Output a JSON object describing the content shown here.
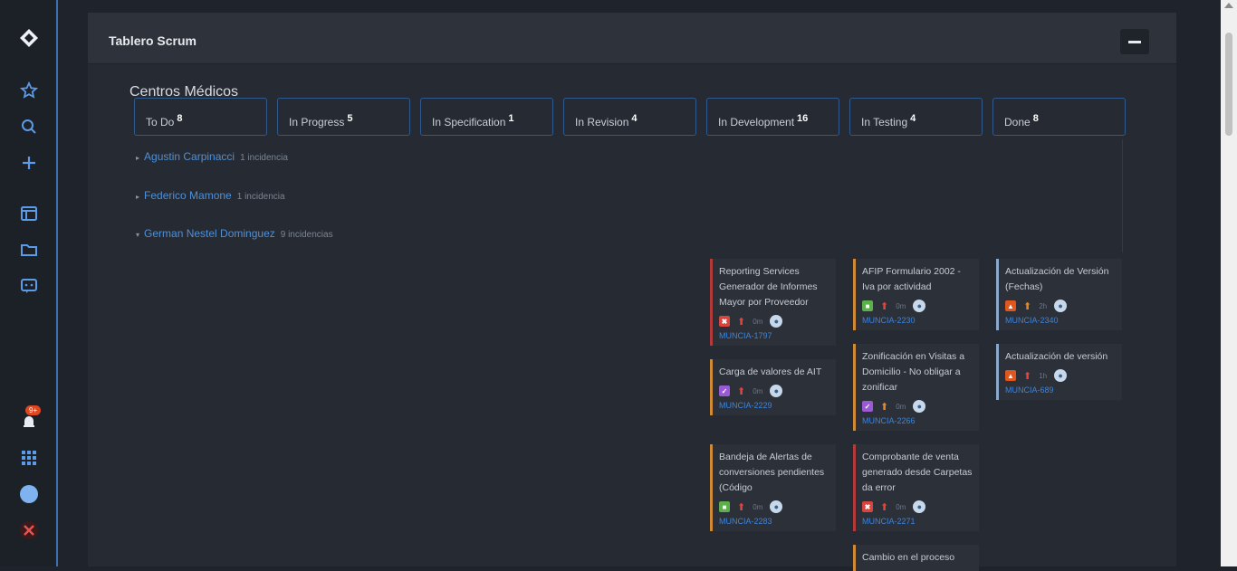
{
  "sidebar": {
    "icons": [
      "jira-logo-icon",
      "star-icon",
      "search-icon",
      "plus-icon",
      "board-icon",
      "folder-icon",
      "feedback-icon",
      "notifications-icon",
      "apps-grid-icon",
      "help-icon",
      "user-avatar-icon"
    ],
    "notification_badge": "9+"
  },
  "panel": {
    "title": "Tablero Scrum",
    "project_title": "Centros Médicos"
  },
  "columns": [
    {
      "name": "To Do",
      "count": "8"
    },
    {
      "name": "In Progress",
      "count": "5"
    },
    {
      "name": "In Specification",
      "count": "1"
    },
    {
      "name": "In Revision",
      "count": "4"
    },
    {
      "name": "In Development",
      "count": "16"
    },
    {
      "name": "In Testing",
      "count": "4"
    },
    {
      "name": "Done",
      "count": "8"
    }
  ],
  "swimlanes": [
    {
      "name": "Agustin Carpinacci",
      "count": "1 incidencia",
      "expanded": false
    },
    {
      "name": "Federico Mamone",
      "count": "1 incidencia",
      "expanded": false
    },
    {
      "name": "German Nestel Dominguez",
      "count": "9 incidencias",
      "expanded": true
    }
  ],
  "cards": {
    "in_development": [
      {
        "title": "Reporting Services Generador de Informes Mayor por Proveedor",
        "type": "bug",
        "estimate": "0m",
        "key": "MUNCIA-1797",
        "accent": "#b33a3a"
      },
      {
        "title": "Carga de valores de AIT",
        "type": "task",
        "estimate": "0m",
        "key": "MUNCIA-2229",
        "accent": "#d08a35"
      },
      {
        "title": "Bandeja de Alertas de conversiones pendientes (Código",
        "type": "story",
        "estimate": "0m",
        "key": "MUNCIA-2283",
        "accent": "#d08a35"
      }
    ],
    "in_testing": [
      {
        "title": "AFIP Formulario 2002 - Iva por actividad",
        "type": "story",
        "estimate": "0m",
        "key": "MUNCIA-2230",
        "accent": "#d08a35"
      },
      {
        "title": "Zonificación en Visitas a Domicilio - No obligar a zonificar",
        "type": "task",
        "estimate": "0m",
        "key": "MUNCIA-2266",
        "accent": "#d08a35"
      },
      {
        "title": "Comprobante de venta generado desde Carpetas da error",
        "type": "bug",
        "estimate": "0m",
        "key": "MUNCIA-2271",
        "accent": "#b33a3a"
      },
      {
        "title": "Cambio en el proceso",
        "type": "task",
        "estimate": "",
        "key": "",
        "accent": "#d08a35"
      }
    ],
    "done": [
      {
        "title": "Actualización de Versión (Fechas)",
        "type": "improvement",
        "estimate": "2h",
        "key": "MUNCIA-2340",
        "accent": "#8aa9cc"
      },
      {
        "title": "Actualización de versión",
        "type": "improvement",
        "estimate": "1h",
        "key": "MUNCIA-689",
        "accent": "#8aa9cc"
      }
    ]
  },
  "colors": {
    "bug": "#d9453d",
    "task": "#9a5ad6",
    "story": "#5bb04a",
    "improvement": "#e0561f",
    "link": "#3f84d9"
  }
}
